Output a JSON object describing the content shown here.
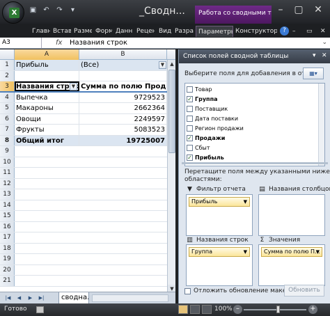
{
  "titlebar": {
    "doc_title": "_Сводн...",
    "context_tab": "Работа со сводными та...",
    "office_logo": "excel-logo",
    "qat_icons": [
      "save-icon",
      "undo-icon",
      "redo-icon",
      "customize-icon"
    ],
    "window_controls": [
      "minimize-icon",
      "maximize-icon",
      "close-icon"
    ]
  },
  "ribbon": {
    "tabs": [
      "Главн",
      "Встав",
      "Разме",
      "Форм",
      "Данн",
      "Рецен",
      "Вид",
      "Разра",
      "Параметры",
      "Конструктор"
    ],
    "active_tab": "Параметры"
  },
  "formula_bar": {
    "name_box": "A3",
    "fx_label": "fx",
    "content": "Названия строк"
  },
  "sheet": {
    "columns": [
      "A",
      "B"
    ],
    "rows": [
      {
        "num": "1",
        "a": "Прибыль",
        "b": "(Все)"
      },
      {
        "num": "2",
        "a": "",
        "b": ""
      },
      {
        "num": "3",
        "a": "Названия строк",
        "b": "Сумма по полю Продажи"
      },
      {
        "num": "4",
        "a": "Выпечка",
        "b": "9729523"
      },
      {
        "num": "5",
        "a": "Макароны",
        "b": "2662364"
      },
      {
        "num": "6",
        "a": "Овощи",
        "b": "2249597"
      },
      {
        "num": "7",
        "a": "Фрукты",
        "b": "5083523"
      },
      {
        "num": "8",
        "a": "Общий итог",
        "b": "19725007"
      },
      {
        "num": "9",
        "a": "",
        "b": ""
      },
      {
        "num": "10",
        "a": "",
        "b": ""
      },
      {
        "num": "11",
        "a": "",
        "b": ""
      },
      {
        "num": "12",
        "a": "",
        "b": ""
      },
      {
        "num": "13",
        "a": "",
        "b": ""
      },
      {
        "num": "14",
        "a": "",
        "b": ""
      },
      {
        "num": "15",
        "a": "",
        "b": ""
      },
      {
        "num": "16",
        "a": "",
        "b": ""
      },
      {
        "num": "17",
        "a": "",
        "b": ""
      },
      {
        "num": "18",
        "a": "",
        "b": ""
      },
      {
        "num": "19",
        "a": "",
        "b": ""
      },
      {
        "num": "20",
        "a": "",
        "b": ""
      },
      {
        "num": "21",
        "a": "",
        "b": ""
      }
    ],
    "sheet_tab": "сводна..."
  },
  "pivot_pane": {
    "title": "Список полей сводной таблицы",
    "choose_label": "Выберите поля для добавления в отчет:",
    "fields": [
      {
        "label": "Товар",
        "checked": false
      },
      {
        "label": "Группа",
        "checked": true
      },
      {
        "label": "Поставщик",
        "checked": false
      },
      {
        "label": "Дата поставки",
        "checked": false
      },
      {
        "label": "Регион продажи",
        "checked": false
      },
      {
        "label": "Продажи",
        "checked": true
      },
      {
        "label": "Сбыт",
        "checked": false
      },
      {
        "label": "Прибыль",
        "checked": true
      }
    ],
    "drag_label_1": "Перетащите поля между указанными ниже",
    "drag_label_2": "областями:",
    "area_filter": "Фильтр отчета",
    "area_columns": "Названия столбцов",
    "area_rows": "Названия строк",
    "area_values": "Значения",
    "filter_chip": "Прибыль",
    "rows_chip": "Группа",
    "values_chip": "Сумма по полю П...",
    "defer_label": "Отложить обновление макета",
    "update_button": "Обновить"
  },
  "status": {
    "ready": "Готово",
    "zoom": "100%"
  }
}
